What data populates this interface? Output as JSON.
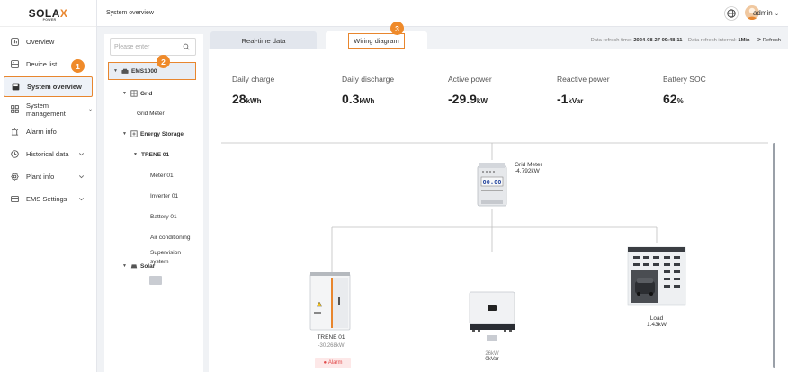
{
  "app": {
    "logo": "SOLAX",
    "logo_sub": "POWER",
    "page_title": "System overview",
    "user": "admin"
  },
  "sidebar": {
    "items": [
      {
        "label": "Overview"
      },
      {
        "label": "Device list"
      },
      {
        "label": "System overview"
      },
      {
        "label": "System management"
      },
      {
        "label": "Alarm info"
      },
      {
        "label": "Historical data"
      },
      {
        "label": "Plant info"
      },
      {
        "label": "EMS Settings"
      }
    ]
  },
  "tree": {
    "search_placeholder": "Please enter",
    "nodes": [
      {
        "label": "EMS1000"
      },
      {
        "label": "Grid"
      },
      {
        "label": "Grid Meter"
      },
      {
        "label": "Energy Storage"
      },
      {
        "label": "TRENE 01"
      },
      {
        "label": "Meter 01"
      },
      {
        "label": "Inverter 01"
      },
      {
        "label": "Battery 01"
      },
      {
        "label": "Air conditioning"
      },
      {
        "label": "Supervision system"
      },
      {
        "label": "Solar"
      }
    ]
  },
  "tabs": [
    {
      "label": "Real-time data"
    },
    {
      "label": "Wiring diagram"
    }
  ],
  "refresh": {
    "time_label": "Data refresh time:",
    "time_value": "2024-08-27 09:48:11",
    "interval_label": "Data refresh interval:",
    "interval_value": "1Min",
    "button": "Refresh"
  },
  "stats": [
    {
      "label": "Daily charge",
      "value": "28",
      "unit": "kWh"
    },
    {
      "label": "Daily discharge",
      "value": "0.3",
      "unit": "kWh"
    },
    {
      "label": "Active power",
      "value": "-29.9",
      "unit": "kW"
    },
    {
      "label": "Reactive power",
      "value": "-1",
      "unit": "kVar"
    },
    {
      "label": "Battery SOC",
      "value": "62",
      "unit": "%"
    }
  ],
  "diagram": {
    "grid_meter": {
      "name": "Grid Meter",
      "value": "-4.792kW",
      "display": "00.00"
    },
    "storage": {
      "name": "TRENE 01",
      "value": "-30.268kW",
      "alarm": "Alarm"
    },
    "inverter": {
      "value1": "26kW",
      "value2": "0kVar"
    },
    "load": {
      "name": "Load",
      "value": "1.43kW"
    }
  },
  "callouts": [
    "1",
    "2",
    "3"
  ],
  "colors": {
    "accent": "#e8862e",
    "badge": "#ef8a2a",
    "alarm": "#e14b4b"
  }
}
